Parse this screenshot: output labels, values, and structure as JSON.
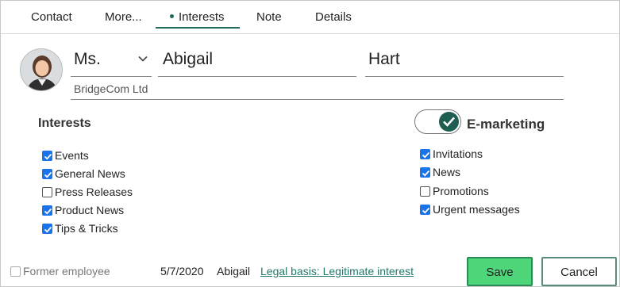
{
  "tabs": [
    {
      "label": "Contact"
    },
    {
      "label": "More..."
    },
    {
      "label": "Interests"
    },
    {
      "label": "Note"
    },
    {
      "label": "Details"
    }
  ],
  "active_tab": "Interests",
  "contact": {
    "salutation": "Ms.",
    "first_name": "Abigail",
    "last_name": "Hart",
    "company": "BridgeCom Ltd"
  },
  "interests": {
    "title": "Interests",
    "items": [
      {
        "label": "Events",
        "checked": true
      },
      {
        "label": "General News",
        "checked": true
      },
      {
        "label": "Press Releases",
        "checked": false
      },
      {
        "label": "Product News",
        "checked": true
      },
      {
        "label": "Tips & Tricks",
        "checked": true
      }
    ]
  },
  "emarketing": {
    "title": "E-marketing",
    "enabled": true,
    "items": [
      {
        "label": "Invitations",
        "checked": true
      },
      {
        "label": "News",
        "checked": true
      },
      {
        "label": "Promotions",
        "checked": false
      },
      {
        "label": "Urgent messages",
        "checked": true
      }
    ]
  },
  "footer": {
    "former_employee_label": "Former employee",
    "former_employee_checked": false,
    "date": "5/7/2020",
    "user": "Abigail",
    "legal_basis": "Legal basis: Legitimate interest",
    "save_label": "Save",
    "cancel_label": "Cancel"
  },
  "colors": {
    "accent": "#1f6b5c",
    "checkbox": "#1a73e8",
    "save_bg": "#4fd67b"
  }
}
